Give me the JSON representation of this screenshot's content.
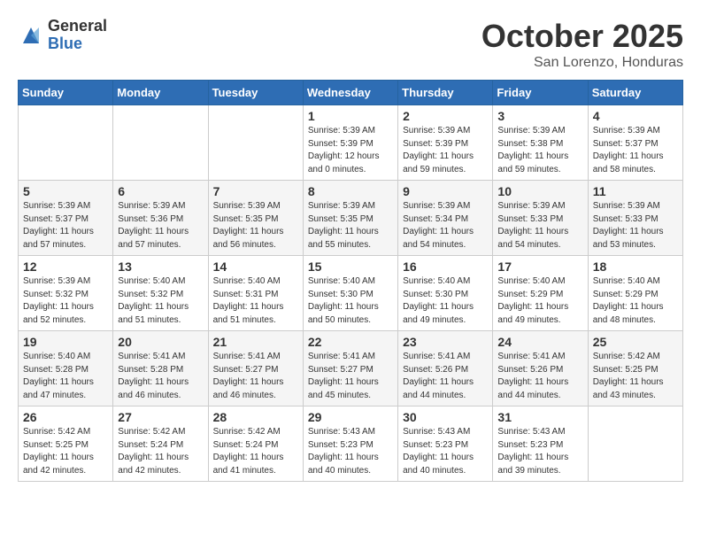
{
  "header": {
    "logo_general": "General",
    "logo_blue": "Blue",
    "month_title": "October 2025",
    "location": "San Lorenzo, Honduras"
  },
  "days_of_week": [
    "Sunday",
    "Monday",
    "Tuesday",
    "Wednesday",
    "Thursday",
    "Friday",
    "Saturday"
  ],
  "weeks": [
    [
      {
        "day": "",
        "info": ""
      },
      {
        "day": "",
        "info": ""
      },
      {
        "day": "",
        "info": ""
      },
      {
        "day": "1",
        "info": "Sunrise: 5:39 AM\nSunset: 5:39 PM\nDaylight: 12 hours and 0 minutes."
      },
      {
        "day": "2",
        "info": "Sunrise: 5:39 AM\nSunset: 5:39 PM\nDaylight: 11 hours and 59 minutes."
      },
      {
        "day": "3",
        "info": "Sunrise: 5:39 AM\nSunset: 5:38 PM\nDaylight: 11 hours and 59 minutes."
      },
      {
        "day": "4",
        "info": "Sunrise: 5:39 AM\nSunset: 5:37 PM\nDaylight: 11 hours and 58 minutes."
      }
    ],
    [
      {
        "day": "5",
        "info": "Sunrise: 5:39 AM\nSunset: 5:37 PM\nDaylight: 11 hours and 57 minutes."
      },
      {
        "day": "6",
        "info": "Sunrise: 5:39 AM\nSunset: 5:36 PM\nDaylight: 11 hours and 57 minutes."
      },
      {
        "day": "7",
        "info": "Sunrise: 5:39 AM\nSunset: 5:35 PM\nDaylight: 11 hours and 56 minutes."
      },
      {
        "day": "8",
        "info": "Sunrise: 5:39 AM\nSunset: 5:35 PM\nDaylight: 11 hours and 55 minutes."
      },
      {
        "day": "9",
        "info": "Sunrise: 5:39 AM\nSunset: 5:34 PM\nDaylight: 11 hours and 54 minutes."
      },
      {
        "day": "10",
        "info": "Sunrise: 5:39 AM\nSunset: 5:33 PM\nDaylight: 11 hours and 54 minutes."
      },
      {
        "day": "11",
        "info": "Sunrise: 5:39 AM\nSunset: 5:33 PM\nDaylight: 11 hours and 53 minutes."
      }
    ],
    [
      {
        "day": "12",
        "info": "Sunrise: 5:39 AM\nSunset: 5:32 PM\nDaylight: 11 hours and 52 minutes."
      },
      {
        "day": "13",
        "info": "Sunrise: 5:40 AM\nSunset: 5:32 PM\nDaylight: 11 hours and 51 minutes."
      },
      {
        "day": "14",
        "info": "Sunrise: 5:40 AM\nSunset: 5:31 PM\nDaylight: 11 hours and 51 minutes."
      },
      {
        "day": "15",
        "info": "Sunrise: 5:40 AM\nSunset: 5:30 PM\nDaylight: 11 hours and 50 minutes."
      },
      {
        "day": "16",
        "info": "Sunrise: 5:40 AM\nSunset: 5:30 PM\nDaylight: 11 hours and 49 minutes."
      },
      {
        "day": "17",
        "info": "Sunrise: 5:40 AM\nSunset: 5:29 PM\nDaylight: 11 hours and 49 minutes."
      },
      {
        "day": "18",
        "info": "Sunrise: 5:40 AM\nSunset: 5:29 PM\nDaylight: 11 hours and 48 minutes."
      }
    ],
    [
      {
        "day": "19",
        "info": "Sunrise: 5:40 AM\nSunset: 5:28 PM\nDaylight: 11 hours and 47 minutes."
      },
      {
        "day": "20",
        "info": "Sunrise: 5:41 AM\nSunset: 5:28 PM\nDaylight: 11 hours and 46 minutes."
      },
      {
        "day": "21",
        "info": "Sunrise: 5:41 AM\nSunset: 5:27 PM\nDaylight: 11 hours and 46 minutes."
      },
      {
        "day": "22",
        "info": "Sunrise: 5:41 AM\nSunset: 5:27 PM\nDaylight: 11 hours and 45 minutes."
      },
      {
        "day": "23",
        "info": "Sunrise: 5:41 AM\nSunset: 5:26 PM\nDaylight: 11 hours and 44 minutes."
      },
      {
        "day": "24",
        "info": "Sunrise: 5:41 AM\nSunset: 5:26 PM\nDaylight: 11 hours and 44 minutes."
      },
      {
        "day": "25",
        "info": "Sunrise: 5:42 AM\nSunset: 5:25 PM\nDaylight: 11 hours and 43 minutes."
      }
    ],
    [
      {
        "day": "26",
        "info": "Sunrise: 5:42 AM\nSunset: 5:25 PM\nDaylight: 11 hours and 42 minutes."
      },
      {
        "day": "27",
        "info": "Sunrise: 5:42 AM\nSunset: 5:24 PM\nDaylight: 11 hours and 42 minutes."
      },
      {
        "day": "28",
        "info": "Sunrise: 5:42 AM\nSunset: 5:24 PM\nDaylight: 11 hours and 41 minutes."
      },
      {
        "day": "29",
        "info": "Sunrise: 5:43 AM\nSunset: 5:23 PM\nDaylight: 11 hours and 40 minutes."
      },
      {
        "day": "30",
        "info": "Sunrise: 5:43 AM\nSunset: 5:23 PM\nDaylight: 11 hours and 40 minutes."
      },
      {
        "day": "31",
        "info": "Sunrise: 5:43 AM\nSunset: 5:23 PM\nDaylight: 11 hours and 39 minutes."
      },
      {
        "day": "",
        "info": ""
      }
    ]
  ]
}
